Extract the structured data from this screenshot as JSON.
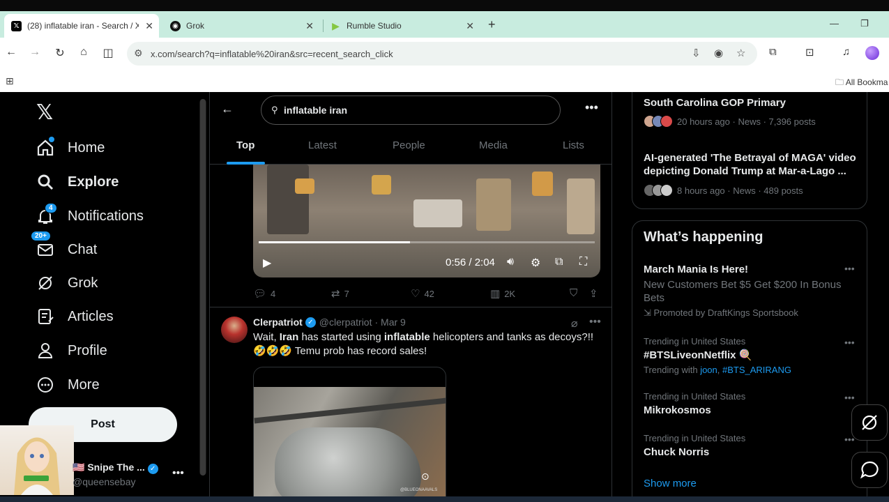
{
  "browser": {
    "tabs": [
      {
        "title": "(28) inflatable iran - Search / X",
        "favicon": "x-logo",
        "active": true
      },
      {
        "title": "Grok",
        "favicon": "grok-logo",
        "active": false
      },
      {
        "title": "Rumble Studio",
        "favicon": "rumble-logo",
        "active": false
      }
    ],
    "url": "x.com/search?q=inflatable%20iran&src=recent_search_click",
    "bookmarks_label": "All Bookma"
  },
  "sidebar": {
    "items": [
      {
        "label": "Home",
        "icon": "home-icon"
      },
      {
        "label": "Explore",
        "icon": "search-icon"
      },
      {
        "label": "Notifications",
        "icon": "bell-icon",
        "badge": "4"
      },
      {
        "label": "Chat",
        "icon": "mail-icon",
        "badge": "20+"
      },
      {
        "label": "Grok",
        "icon": "grok-icon"
      },
      {
        "label": "Articles",
        "icon": "article-icon"
      },
      {
        "label": "Profile",
        "icon": "person-icon"
      },
      {
        "label": "More",
        "icon": "more-circle-icon"
      }
    ],
    "post_label": "Post",
    "account": {
      "name": "Snipe The ...",
      "handle": "@queensebay",
      "flag": "🇺🇸"
    }
  },
  "search": {
    "query": "inflatable iran",
    "tabs": [
      "Top",
      "Latest",
      "People",
      "Media",
      "Lists"
    ],
    "active_tab": "Top"
  },
  "tweet1": {
    "video_time": "0:56 / 2:04",
    "video_progress": 0.45,
    "replies": "4",
    "reposts": "7",
    "likes": "42",
    "views": "2K"
  },
  "tweet2": {
    "name": "Clerpatriot",
    "handle": "@clerpatriot",
    "date": "· Mar 9",
    "text_1": "Wait, ",
    "text_b1": "Iran",
    "text_2": " has started using ",
    "text_b2": "inflatable",
    "text_3": " helicopters and tanks as decoys?!!",
    "text_line2": "🤣🤣🤣 Temu prob has record sales!",
    "media_tag": "@BLUEONAAVALS"
  },
  "right": {
    "trend_top": {
      "headline": "South Carolina GOP Primary",
      "meta": "20 hours ago · News · 7,396 posts"
    },
    "trend_ai": {
      "headline": "AI-generated 'The Betrayal of MAGA' video depicting Donald Trump at Mar-a-Lago ...",
      "meta": "8 hours ago · News · 489 posts"
    },
    "whats_happening": "What’s happening",
    "promo": {
      "title": "March Mania Is Here!",
      "body": "New Customers Bet $5 Get $200 In Bonus Bets",
      "promoted": "Promoted by DraftKings Sportsbook"
    },
    "trends": [
      {
        "context": "Trending in United States",
        "name": "#BTSLiveonNetflix 🍭",
        "with_label": "Trending with",
        "with_1": "joon",
        "with_2": "#BTS_ARIRANG"
      },
      {
        "context": "Trending in United States",
        "name": "Mikrokosmos"
      },
      {
        "context": "Trending in United States",
        "name": "Chuck Norris"
      }
    ],
    "show_more": "Show more"
  },
  "colors": {
    "accent": "#1d9bf0",
    "background": "#000000",
    "chrome": "#c8ecdf"
  }
}
